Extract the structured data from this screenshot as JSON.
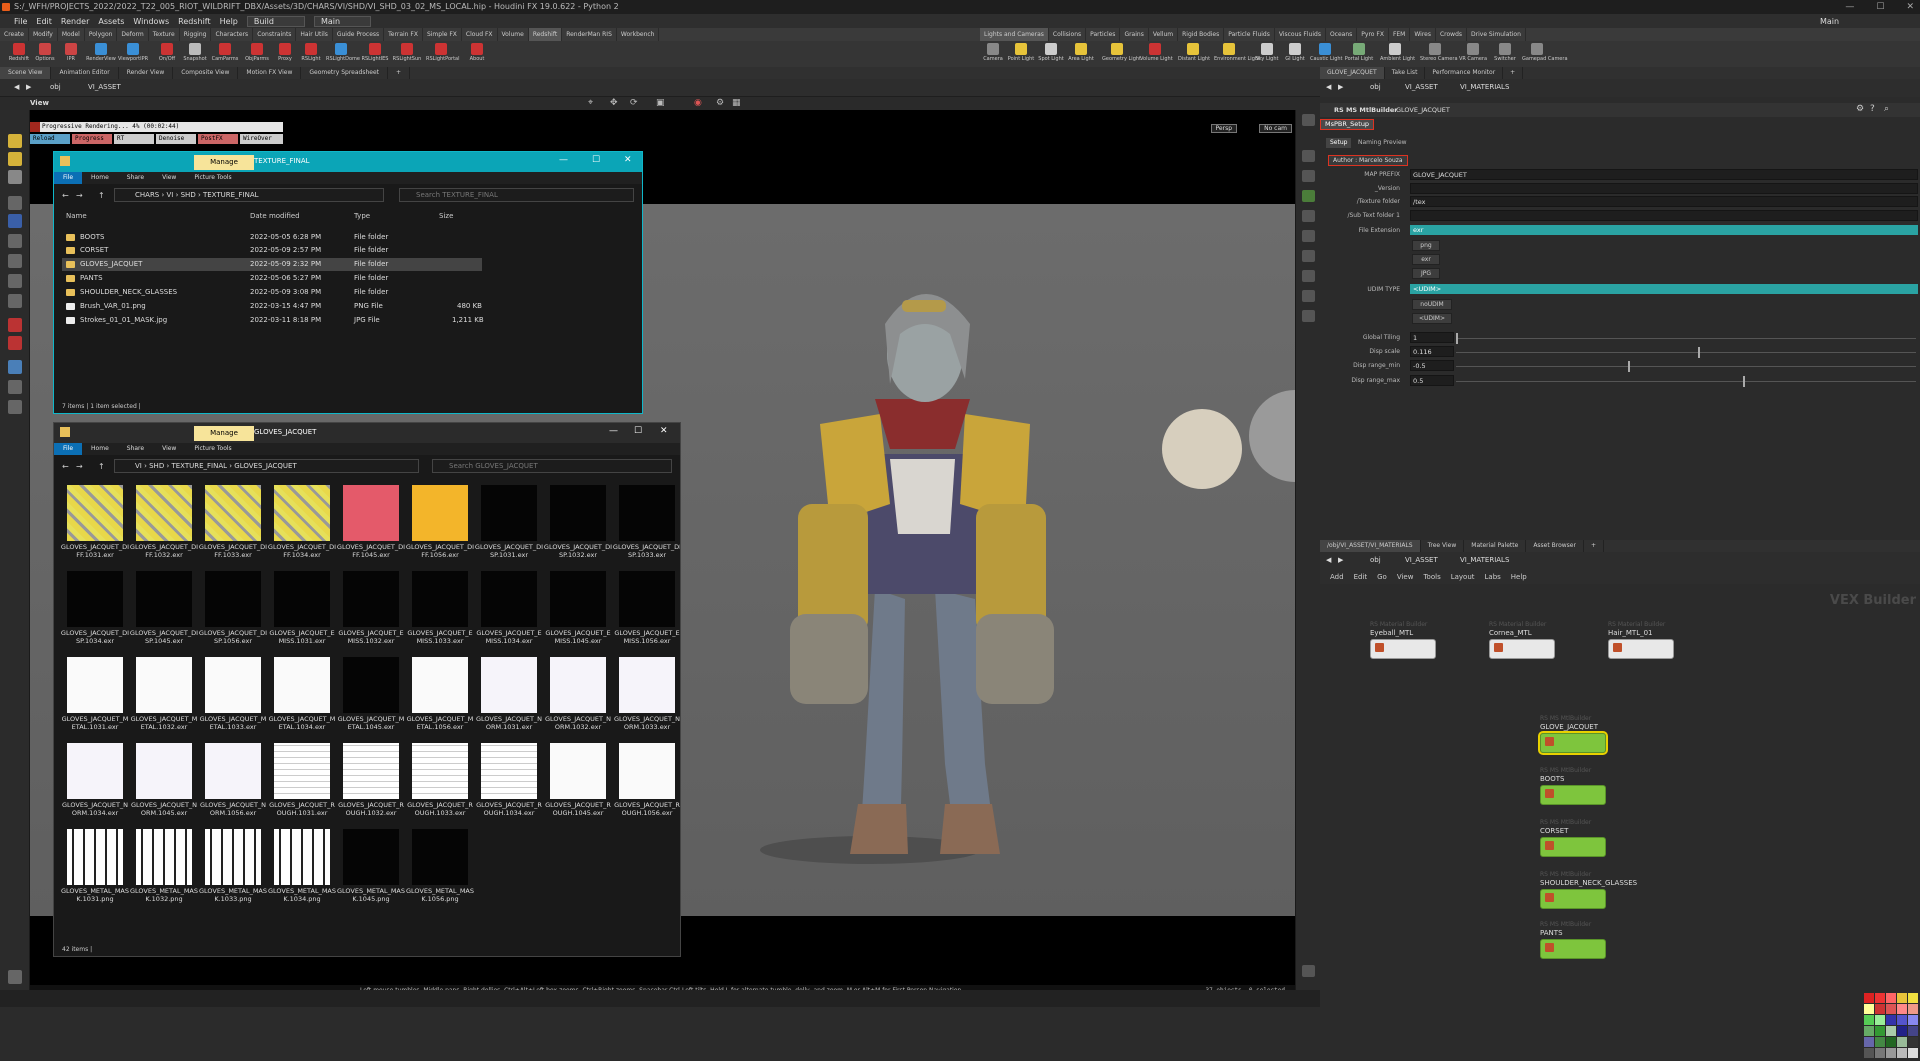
{
  "window_title": "S:/_WFH/PROJECTS_2022/2022_T22_005_RIOT_WILDRIFT_DBX/Assets/3D/CHARS/VI/SHD/VI_SHD_03_02_MS_LOCAL.hip - Houdini FX 19.0.622 - Python 2",
  "menu": [
    "File",
    "Edit",
    "Render",
    "Assets",
    "Windows",
    "Redshift",
    "Help"
  ],
  "desktop": "Build",
  "main_label": "Main",
  "main_right": "Main",
  "shelf_tabs_left": [
    "Create",
    "Modify",
    "Model",
    "Polygon",
    "Deform",
    "Texture",
    "Rigging",
    "Characters",
    "Constraints",
    "Hair Utils",
    "Guide Process",
    "Terrain FX",
    "Simple FX",
    "Cloud FX",
    "Volume",
    "Redshift",
    "RenderMan RIS",
    "Workbench"
  ],
  "shelf_tabs_right": [
    "Lights and Cameras",
    "Collisions",
    "Particles",
    "Grains",
    "Vellum",
    "Rigid Bodies",
    "Particle Fluids",
    "Viscous Fluids",
    "Oceans",
    "Pyro FX",
    "FEM",
    "Wires",
    "Crowds",
    "Drive Simulation"
  ],
  "shelf_icons_left": [
    "Redshift",
    "Options",
    "IPR",
    "RenderView",
    "ViewportIPR",
    "On/Off",
    "Snapshot",
    "CamParms",
    "ObjParms",
    "Proxy",
    "RSLight",
    "RSLightDome",
    "RSLightIES",
    "RSLightSun",
    "RSLightPortal",
    "About"
  ],
  "shelf_icons_right": [
    "Camera",
    "Point Light",
    "Spot Light",
    "Area Light",
    "Geometry Light",
    "Volume Light",
    "Distant Light",
    "Environment Light",
    "Sky Light",
    "GI Light",
    "Caustic Light",
    "Portal Light",
    "Ambient Light",
    "Stereo Camera",
    "VR Camera",
    "Switcher",
    "Gamepad Camera"
  ],
  "pane_tabs": [
    "Scene View",
    "Animation Editor",
    "Render View",
    "Composite View",
    "Motion FX View",
    "Geometry Spreadsheet"
  ],
  "path_obj": "obj",
  "path_asset": "VI_ASSET",
  "view_label": "View",
  "render_status": {
    "text": "Progressive Rendering...   4%  (00:02:44)",
    "buttons": [
      "Reload",
      "Progress",
      "RT",
      "Denoise",
      "PostFX",
      "WireOver"
    ]
  },
  "persp": "Persp",
  "nocam": "No cam",
  "viewport_hint": "Left mouse tumbles. Middle pans. Right dollies. Ctrl+Alt+Left box-zooms. Ctrl+Right zooms. Spacebar-Ctrl-Left tilts. Hold L for alternate tumble, dolly, and zoom.    M or Alt+M for First Person Navigation.",
  "viewport_count": "37 objects, 0 selected",
  "explorer1": {
    "title": "TEXTURE_FINAL",
    "manage": "Manage",
    "ribbon": [
      "File",
      "Home",
      "Share",
      "View",
      "Picture Tools"
    ],
    "path": [
      "CHARS",
      "VI",
      "SHD",
      "TEXTURE_FINAL"
    ],
    "search": "Search TEXTURE_FINAL",
    "columns": [
      "Name",
      "Date modified",
      "Type",
      "Size"
    ],
    "rows": [
      {
        "name": "BOOTS",
        "date": "2022-05-05 6:28 PM",
        "type": "File folder",
        "size": ""
      },
      {
        "name": "CORSET",
        "date": "2022-05-09 2:57 PM",
        "type": "File folder",
        "size": ""
      },
      {
        "name": "GLOVES_JACQUET",
        "date": "2022-05-09 2:32 PM",
        "type": "File folder",
        "size": ""
      },
      {
        "name": "PANTS",
        "date": "2022-05-06 5:27 PM",
        "type": "File folder",
        "size": ""
      },
      {
        "name": "SHOULDER_NECK_GLASSES",
        "date": "2022-05-09 3:08 PM",
        "type": "File folder",
        "size": ""
      },
      {
        "name": "Brush_VAR_01.png",
        "date": "2022-03-15 4:47 PM",
        "type": "PNG File",
        "size": "480 KB"
      },
      {
        "name": "Strokes_01_01_MASK.jpg",
        "date": "2022-03-11 8:18 PM",
        "type": "JPG File",
        "size": "1,211 KB"
      }
    ],
    "status": "7 items  |  1 item selected  |"
  },
  "explorer2": {
    "title": "GLOVES_JACQUET",
    "manage": "Manage",
    "ribbon": [
      "File",
      "Home",
      "Share",
      "View",
      "Picture Tools"
    ],
    "path": [
      "VI",
      "SHD",
      "TEXTURE_FINAL",
      "GLOVES_JACQUET"
    ],
    "search": "Search GLOVES_JACQUET",
    "status": "42 items  |",
    "files": [
      "GLOVES_JACQUET_DIFF.1031.exr",
      "GLOVES_JACQUET_DIFF.1032.exr",
      "GLOVES_JACQUET_DIFF.1033.exr",
      "GLOVES_JACQUET_DIFF.1034.exr",
      "GLOVES_JACQUET_DIFF.1045.exr",
      "GLOVES_JACQUET_DIFF.1056.exr",
      "GLOVES_JACQUET_DISP.1031.exr",
      "GLOVES_JACQUET_DISP.1032.exr",
      "GLOVES_JACQUET_DISP.1033.exr",
      "GLOVES_JACQUET_DISP.1034.exr",
      "GLOVES_JACQUET_DISP.1045.exr",
      "GLOVES_JACQUET_DISP.1056.exr",
      "GLOVES_JACQUET_EMISS.1031.exr",
      "GLOVES_JACQUET_EMISS.1032.exr",
      "GLOVES_JACQUET_EMISS.1033.exr",
      "GLOVES_JACQUET_EMISS.1034.exr",
      "GLOVES_JACQUET_EMISS.1045.exr",
      "GLOVES_JACQUET_EMISS.1056.exr",
      "GLOVES_JACQUET_METAL.1031.exr",
      "GLOVES_JACQUET_METAL.1032.exr",
      "GLOVES_JACQUET_METAL.1033.exr",
      "GLOVES_JACQUET_METAL.1034.exr",
      "GLOVES_JACQUET_METAL.1045.exr",
      "GLOVES_JACQUET_METAL.1056.exr",
      "GLOVES_JACQUET_NORM.1031.exr",
      "GLOVES_JACQUET_NORM.1032.exr",
      "GLOVES_JACQUET_NORM.1033.exr",
      "GLOVES_JACQUET_NORM.1034.exr",
      "GLOVES_JACQUET_NORM.1045.exr",
      "GLOVES_JACQUET_NORM.1056.exr",
      "GLOVES_JACQUET_ROUGH.1031.exr",
      "GLOVES_JACQUET_ROUGH.1032.exr",
      "GLOVES_JACQUET_ROUGH.1033.exr",
      "GLOVES_JACQUET_ROUGH.1034.exr",
      "GLOVES_JACQUET_ROUGH.1045.exr",
      "GLOVES_JACQUET_ROUGH.1056.exr",
      "GLOVES_METAL_MASK.1031.png",
      "GLOVES_METAL_MASK.1032.png",
      "GLOVES_METAL_MASK.1033.png",
      "GLOVES_METAL_MASK.1034.png",
      "GLOVES_METAL_MASK.1045.png",
      "GLOVES_METAL_MASK.1056.png"
    ]
  },
  "right_tabs_top": [
    "GLOVE_JACQUET",
    "Take List",
    "Performance Monitor"
  ],
  "rpath": {
    "obj": "obj",
    "asset": "VI_ASSET",
    "mat": "VI_MATERIALS"
  },
  "node_header": {
    "type": "RS MS MtlBuilder",
    "name": "GLOVE_JACQUET"
  },
  "folder_tab": "MsPBR_Setup",
  "sub_tabs": [
    "Setup",
    "Naming Preview"
  ],
  "author": "Author : Marcelo Souza",
  "params": {
    "map_prefix_label": "MAP PREFIX",
    "map_prefix": "GLOVE_JACQUET",
    "version_label": "_Version",
    "version": "",
    "tex_folder_label": "/Texture folder",
    "tex_folder": "/tex",
    "sub_folder_label": "/Sub Text folder 1",
    "sub_folder": "",
    "file_ext_label": "File Extension",
    "file_ext": "exr",
    "ext_btns": [
      "png",
      "exr",
      "JPG"
    ],
    "udim_label": "UDIM TYPE",
    "udim": "<UDIM>",
    "udim_btns": [
      "noUDIM",
      "<UDIM>"
    ],
    "tiling_label": "Global Tiling",
    "tiling": "1",
    "disp_label": "Disp scale",
    "disp": "0.116",
    "dmin_label": "Disp range_min",
    "dmin": "-0.5",
    "dmax_label": "Disp range_max",
    "dmax": "0.5"
  },
  "net_tabs": [
    "/obj/VI_ASSET/VI_MATERIALS",
    "Tree View",
    "Material Palette",
    "Asset Browser"
  ],
  "net_menu": [
    "Add",
    "Edit",
    "Go",
    "View",
    "Tools",
    "Layout",
    "Labs",
    "Help"
  ],
  "vex_label": "VEX Builder",
  "nodes_top": [
    {
      "type": "RS Material Builder",
      "name": "Eyeball_MTL"
    },
    {
      "type": "RS Material Builder",
      "name": "Cornea_MTL"
    },
    {
      "type": "RS Material Builder",
      "name": "Hair_MTL_01"
    }
  ],
  "nodes_ms": [
    {
      "type": "RS MS MtlBuilder",
      "name": "GLOVE_JACQUET"
    },
    {
      "type": "RS MS MtlBuilder",
      "name": "BOOTS"
    },
    {
      "type": "RS MS MtlBuilder",
      "name": "CORSET"
    },
    {
      "type": "RS MS MtlBuilder",
      "name": "SHOULDER_NECK_GLASSES"
    },
    {
      "type": "RS MS MtlBuilder",
      "name": "PANTS"
    }
  ]
}
